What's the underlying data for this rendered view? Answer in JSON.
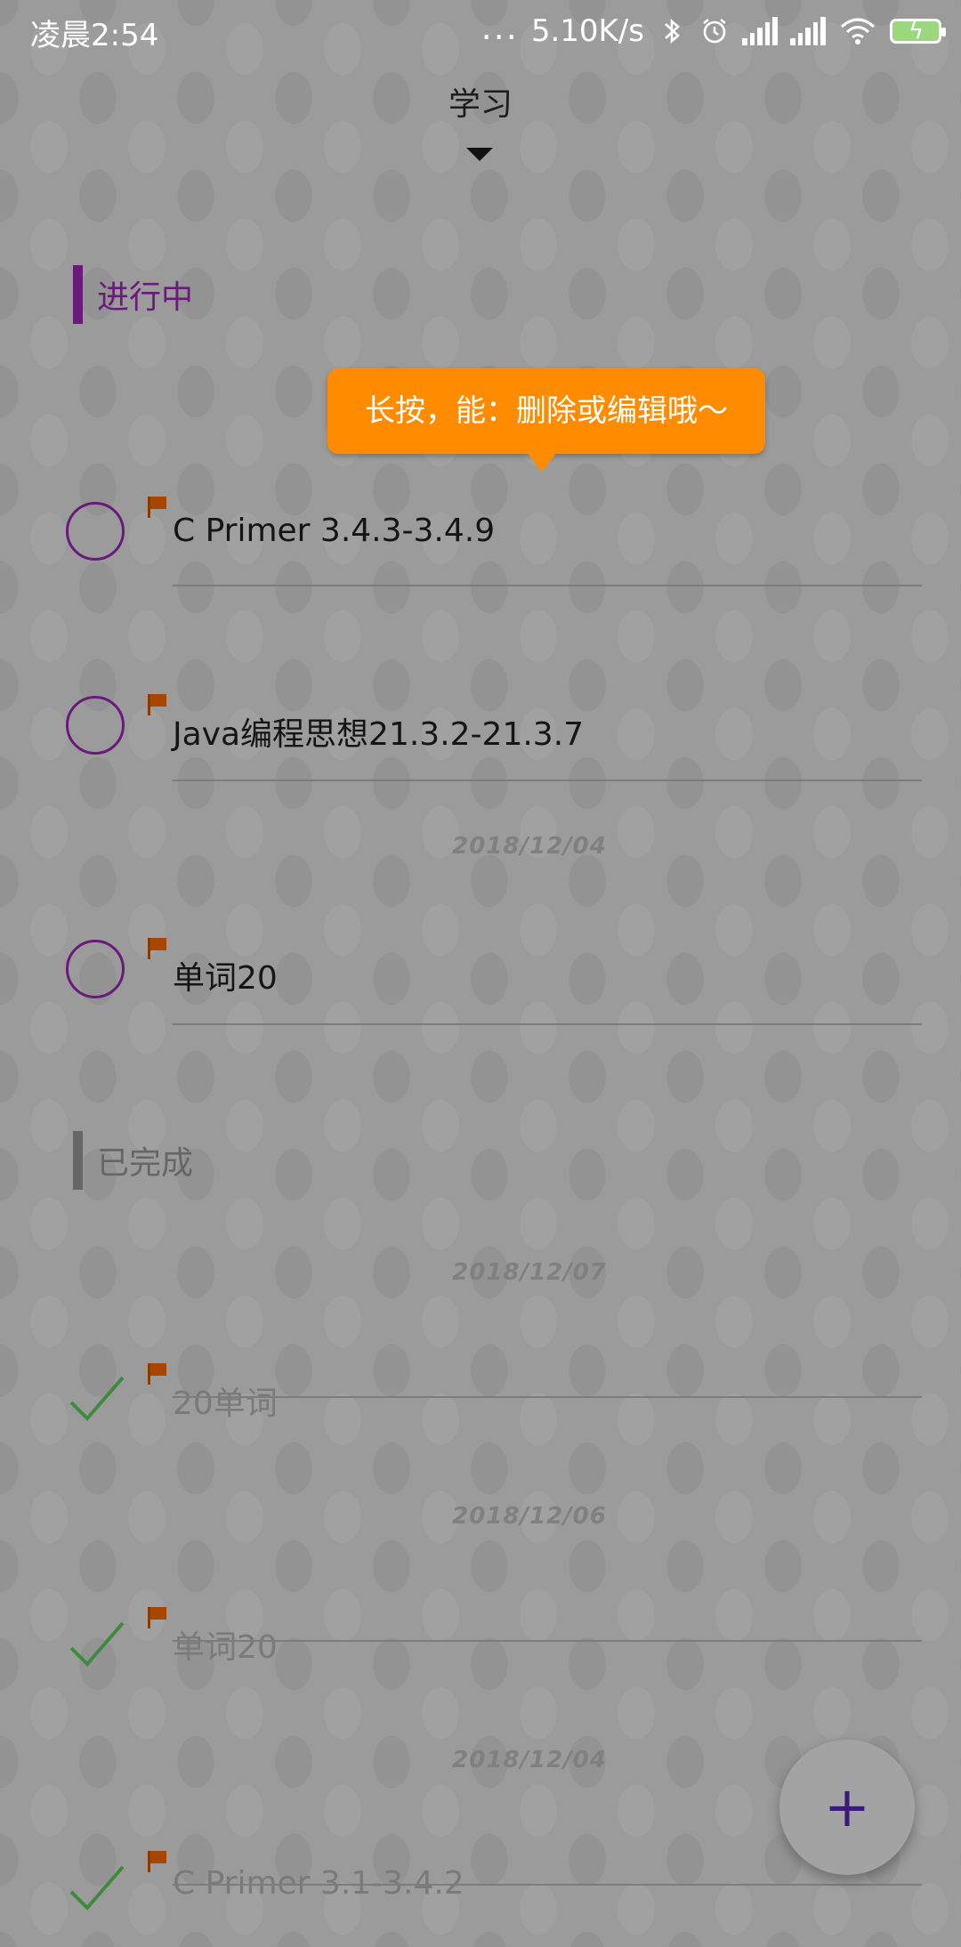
{
  "status_bar": {
    "time": "凌晨2:54",
    "dots": "...",
    "network_speed": "5.10K/s",
    "icons": [
      "bluetooth-icon",
      "alarm-icon",
      "signal-icon",
      "signal-icon",
      "wifi-icon",
      "battery-charging-icon"
    ]
  },
  "header": {
    "title": "学习",
    "dropdown_icon": "caret-down-icon"
  },
  "sections": {
    "in_progress": {
      "label": "进行中",
      "color": "#6a1a7a"
    },
    "completed": {
      "label": "已完成",
      "color": "#666666"
    }
  },
  "tooltip": {
    "text": "长按，能：删除或编辑哦～",
    "color": "#ff8c00"
  },
  "todos_in_progress": [
    {
      "text": "C Primer 3.4.3-3.4.9"
    },
    {
      "text": "Java编程思想21.3.2-21.3.7"
    },
    {
      "date": "2018/12/04",
      "text": "单词20"
    }
  ],
  "todos_completed": [
    {
      "date": "2018/12/07",
      "text": "20单词"
    },
    {
      "date": "2018/12/06",
      "text": "单词20"
    },
    {
      "date": "2018/12/04",
      "text": "C Primer 3.1-3.4.2"
    }
  ],
  "fab": {
    "label": "+",
    "icon": "plus-icon"
  },
  "colors": {
    "accent_purple": "#6a1a7a",
    "flag": "#a84600",
    "check_green": "#3f8a3f",
    "fab_plus": "#3a1a7a"
  }
}
